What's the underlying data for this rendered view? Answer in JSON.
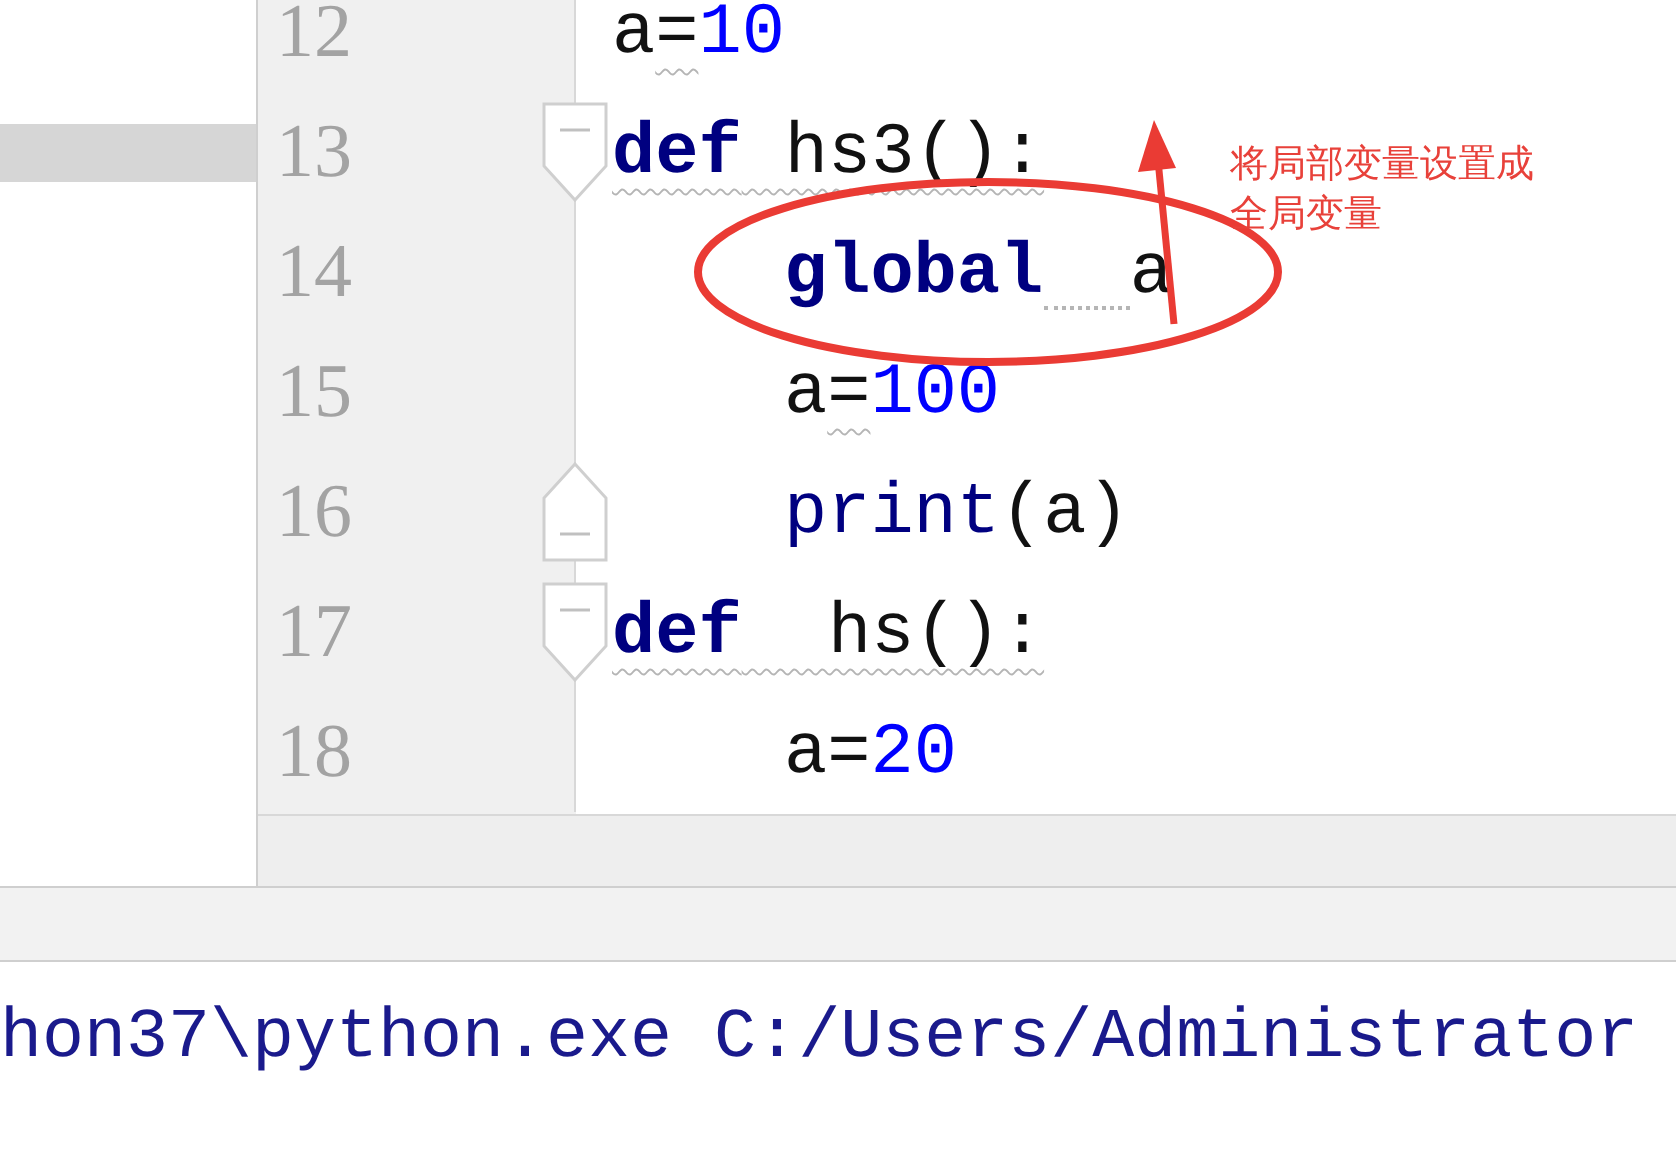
{
  "editor": {
    "lines": [
      {
        "number": "12",
        "fold_marker": false,
        "tokens": [
          {
            "kind": "name",
            "text": "a",
            "warning": false
          },
          {
            "kind": "operator",
            "text": "=",
            "warning": true
          },
          {
            "kind": "number",
            "text": "10",
            "warning": false
          }
        ]
      },
      {
        "number": "13",
        "fold_marker": true,
        "tokens": [
          {
            "kind": "keyword",
            "text": "def",
            "warning": true
          },
          {
            "kind": "name",
            "text": " hs3():",
            "warning": true
          }
        ],
        "children": [
          {
            "number": "14",
            "fold_marker": false,
            "tokens": [
              {
                "kind": "keyword",
                "text": "global",
                "warning": false
              },
              {
                "kind": "gap",
                "warning": true
              },
              {
                "kind": "name",
                "text": "a",
                "warning": false
              }
            ]
          },
          {
            "number": "15",
            "fold_marker": false,
            "tokens": [
              {
                "kind": "name",
                "text": "a",
                "warning": false
              },
              {
                "kind": "operator",
                "text": "=",
                "warning": true
              },
              {
                "kind": "number",
                "text": "100",
                "warning": false
              }
            ]
          },
          {
            "number": "16",
            "fold_marker": true,
            "tokens": [
              {
                "kind": "builtin",
                "text": "print",
                "warning": false
              },
              {
                "kind": "name",
                "text": "(a)",
                "warning": false
              }
            ]
          }
        ]
      },
      {
        "number": "17",
        "fold_marker": true,
        "tokens": [
          {
            "kind": "keyword",
            "text": "def",
            "warning": true
          },
          {
            "kind": "name",
            "text": "  hs():",
            "warning": true
          }
        ],
        "children": [
          {
            "number": "18",
            "fold_marker": false,
            "tokens": [
              {
                "kind": "name",
                "text": "a",
                "warning": false
              },
              {
                "kind": "operator",
                "text": "=",
                "warning": false
              },
              {
                "kind": "number",
                "text": "20",
                "warning": false
              }
            ]
          }
        ]
      }
    ]
  },
  "annotation": {
    "note": "将局部变量设置成全局变量"
  },
  "console": {
    "line": "hon37\\python.exe C:/Users/Administrator"
  }
}
